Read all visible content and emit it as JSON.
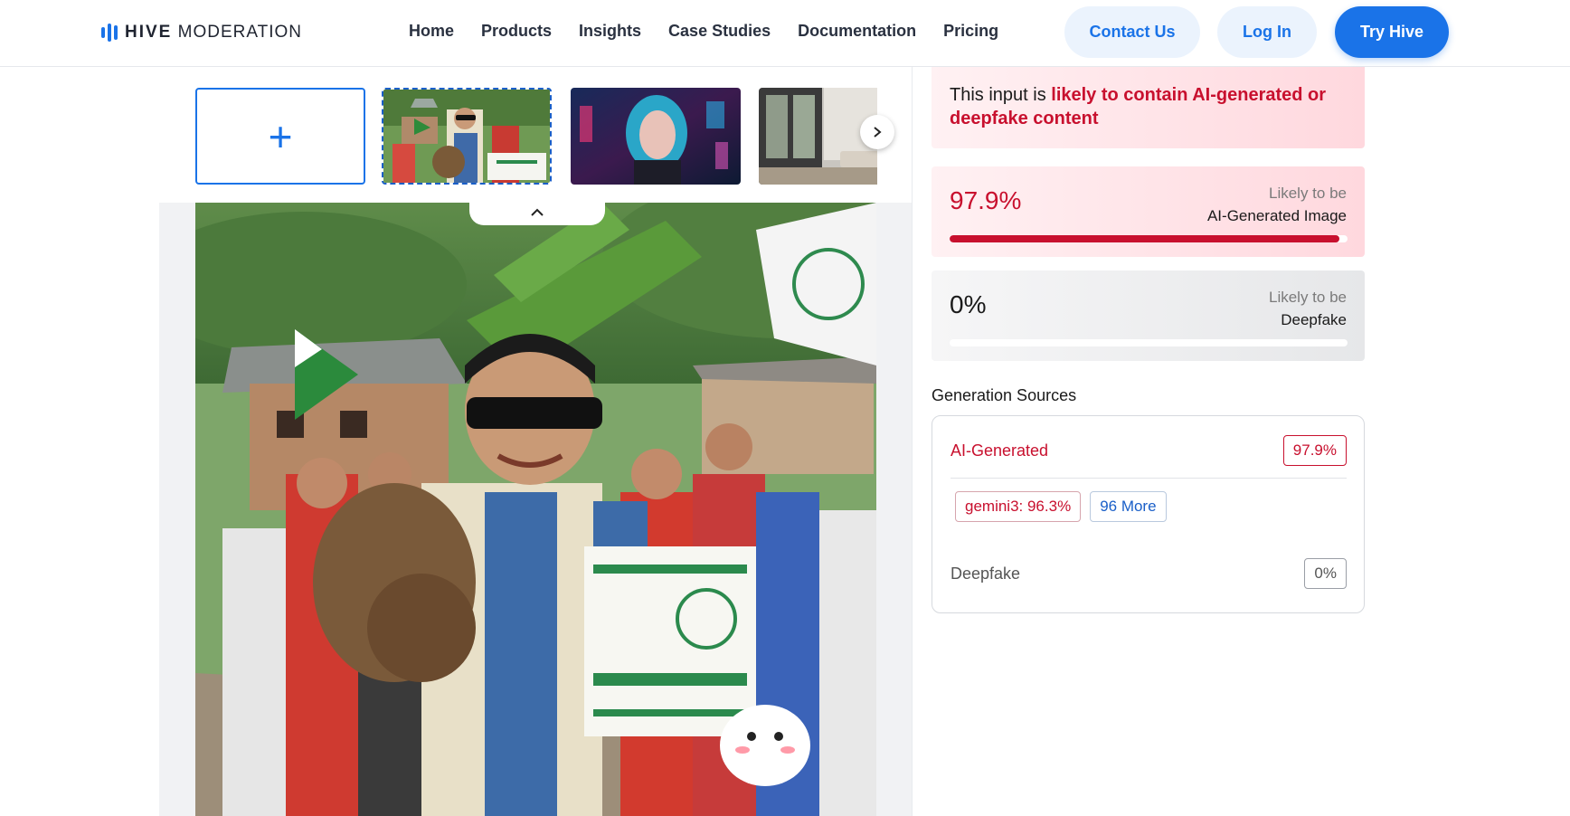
{
  "header": {
    "logo_bold": "HIVE",
    "logo_light": "MODERATION",
    "nav": [
      "Home",
      "Products",
      "Insights",
      "Case Studies",
      "Documentation",
      "Pricing"
    ],
    "contact_label": "Contact Us",
    "login_label": "Log In",
    "try_label": "Try Hive"
  },
  "upload": {
    "plus": "+"
  },
  "result": {
    "verdict_prefix": "This input is ",
    "verdict_highlight": "likely to contain AI-generated or deepfake content",
    "ai_score": "97.9%",
    "ai_fraction": 0.979,
    "ai_label_sub": "Likely to be",
    "ai_label_main": "AI-Generated Image",
    "df_score": "0%",
    "df_fraction": 0.0,
    "df_label_sub": "Likely to be",
    "df_label_main": "Deepfake"
  },
  "sources": {
    "title": "Generation Sources",
    "ai_label": "AI-Generated",
    "ai_value": "97.9%",
    "model_tag": "gemini3: 96.3%",
    "more_tag": "96 More",
    "df_label": "Deepfake",
    "df_value": "0%"
  },
  "colors": {
    "accent": "#1a73e8",
    "danger": "#c8102e"
  }
}
